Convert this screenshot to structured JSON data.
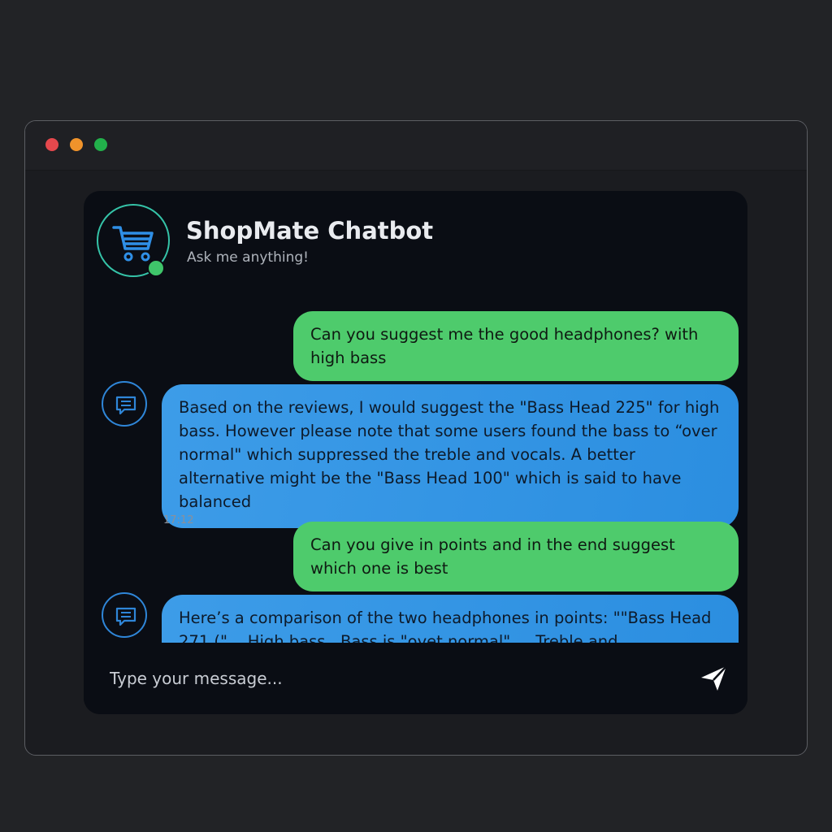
{
  "window": {
    "controls": [
      {
        "name": "close",
        "color": "#e5484d"
      },
      {
        "name": "minimize",
        "color": "#f0932b"
      },
      {
        "name": "maximize",
        "color": "#22b04b"
      }
    ]
  },
  "chat": {
    "bot_name": "ShopMate Chatbot",
    "tagline": "Ask me anything!",
    "avatar_icon": "shopping-cart-icon",
    "online_status_color": "#3fc56a",
    "accent_color": "#35c3a8",
    "user_bubble_color": "#4ecb6c",
    "bot_bubble_color": "#3296e4",
    "messages": [
      {
        "sender": "user",
        "text": "Can you suggest me the good headphones? with high bass"
      },
      {
        "sender": "bot",
        "avatar_icon": "chat-bubble-icon",
        "text": "Based on the reviews, I would suggest the \"Bass Head 225\" for high bass. However  please note that some users found the bass to “over normal\" which suppressed the treble and vocals. A better alternative might be the \"Bass Head 100\" which is said to have balanced",
        "time": "17:12"
      },
      {
        "sender": "user",
        "text": "Can you give in points and in the end suggest which one is best"
      },
      {
        "sender": "bot",
        "avatar_icon": "chat-bubble-icon",
        "text": "Here’s a comparison of the two headphones in points: \"\"Bass Head 271 (\"... High bass...Bass is \"ovet normal\" ... Treble and"
      }
    ]
  },
  "composer": {
    "placeholder": "Type your message...",
    "send_icon": "send-arrow-icon"
  }
}
